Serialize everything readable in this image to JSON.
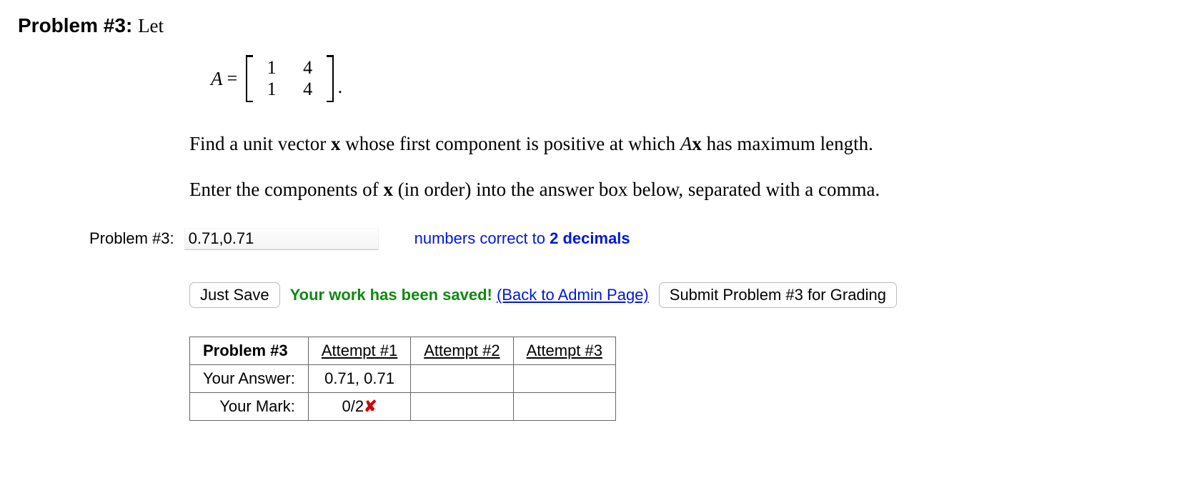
{
  "header": {
    "problem_label": "Problem #3:",
    "let_text": "Let"
  },
  "matrix": {
    "name": "A",
    "eq": "=",
    "rows": [
      [
        "1",
        "4"
      ],
      [
        "1",
        "4"
      ]
    ],
    "period": "."
  },
  "prose": {
    "line1_pre": "Find a unit vector ",
    "line1_x": "x",
    "line1_mid": " whose first component is positive at which ",
    "line1_A": "A",
    "line1_x2": "x",
    "line1_post": " has maximum length.",
    "line2_pre": "Enter the components of ",
    "line2_x": "x",
    "line2_post": " (in order) into the answer box below, separated with a comma."
  },
  "answer": {
    "label": "Problem #3:",
    "value": "0.71,0.71",
    "hint_pre": "numbers correct to ",
    "hint_bold": "2 decimals"
  },
  "actions": {
    "just_save": "Just Save",
    "saved_msg": "Your work has been saved!",
    "back_link": "(Back to Admin Page)",
    "submit": "Submit Problem #3 for Grading"
  },
  "results": {
    "header_first": "Problem #3",
    "attempts": [
      "Attempt #1",
      "Attempt #2",
      "Attempt #3"
    ],
    "row_answer_label": "Your Answer:",
    "row_answer_values": [
      "0.71, 0.71",
      "",
      ""
    ],
    "row_mark_label": "Your Mark:",
    "row_mark_values": [
      "0/2",
      "",
      ""
    ],
    "mark_suffix_wrong": "✘"
  }
}
